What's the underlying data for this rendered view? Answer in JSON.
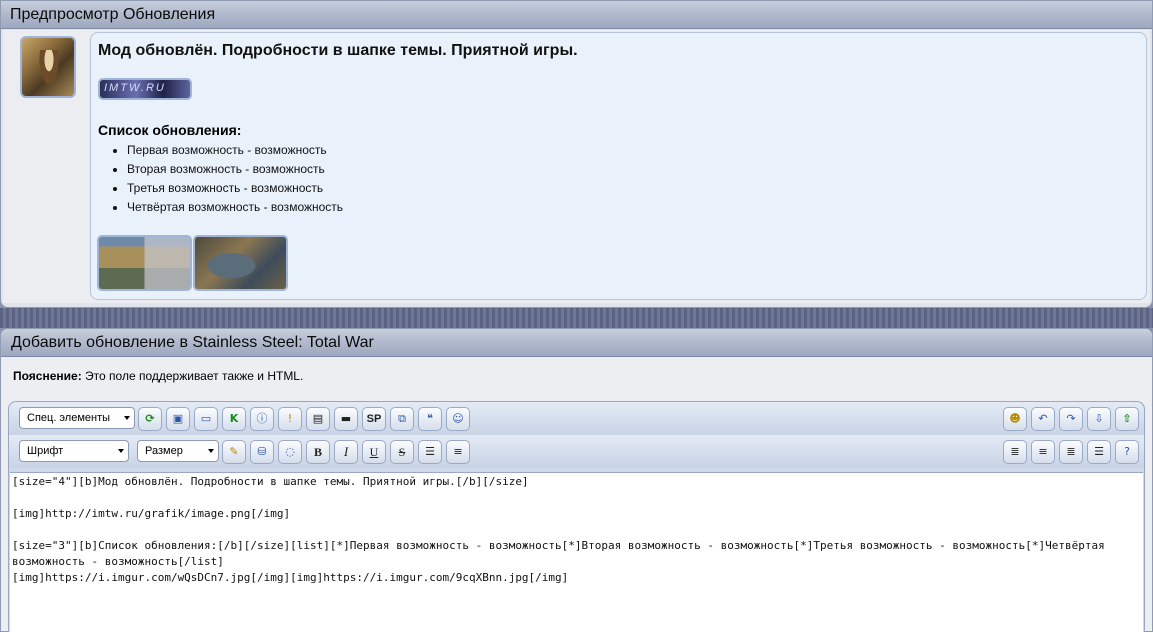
{
  "preview": {
    "title": "Предпросмотр Обновления",
    "heading": "Мод обновлён. Подробности в шапке темы. Приятной игры.",
    "banner_text": "IMTW.RU",
    "list_title": "Список обновления:",
    "list_items": [
      "Первая возможность - возможность",
      "Вторая возможность - возможность",
      "Третья возможность - возможность",
      "Четвёртая возможность - возможность"
    ]
  },
  "add_update": {
    "title": "Добавить обновление в Stainless Steel: Total War",
    "note_label": "Пояснение:",
    "note_text": " Это поле поддерживает также и HTML."
  },
  "editor": {
    "special_select": "Спец. элементы",
    "font_select": "Шрифт",
    "size_select": "Размер",
    "sp_label": "SP",
    "bold_label": "B",
    "italic_label": "I",
    "underline_label": "U",
    "strike_label": "S",
    "content": "[size=\"4\"][b]Мод обновлён. Подробности в шапке темы. Приятной игры.[/b][/size]\n\n[img]http://imtw.ru/grafik/image.png[/img]\n\n[size=\"3\"][b]Список обновления:[/b][/size][list][*]Первая возможность - возможность[*]Вторая возможность - возможность[*]Третья возможность - возможность[*]Четвёртая возможность - возможность[/list]\n[img]https://i.imgur.com/wQsDCn7.jpg[/img][img]https://i.imgur.com/9cqXBnn.jpg[/img]"
  },
  "icons": {
    "toolbar1_left": [
      "special-elements-select",
      "refresh-icon",
      "image-icon",
      "window-icon",
      "k-icon",
      "info-icon",
      "warning-icon",
      "page-icon",
      "hr-icon",
      "spoiler-icon",
      "windows-icon",
      "quote-icon",
      "user-icon"
    ],
    "toolbar1_right": [
      "smiley-icon",
      "undo-icon",
      "redo-icon",
      "download-icon",
      "upload-icon"
    ],
    "toolbar2_right": [
      "align-left-icon",
      "align-center-icon",
      "align-right-icon",
      "justify-icon",
      "help-icon"
    ]
  }
}
